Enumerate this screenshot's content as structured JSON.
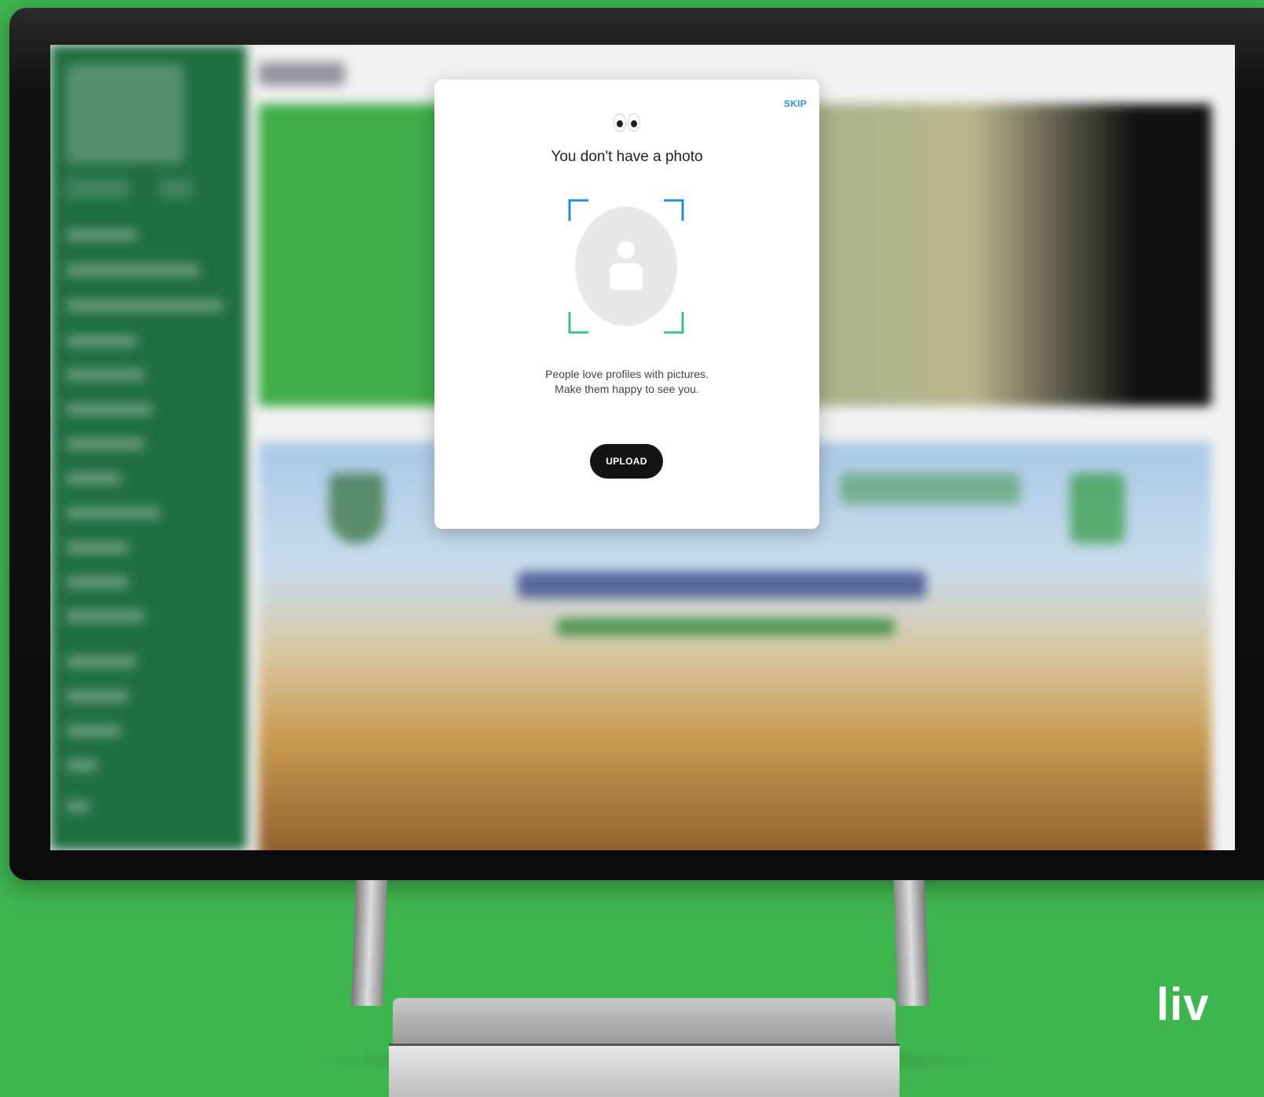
{
  "modal": {
    "skip_label": "SKIP",
    "eyes_icon": "👀",
    "title": "You don't have a photo",
    "description": "People love profiles with pictures. Make them happy to see you.",
    "upload_label": "UPLOAD",
    "avatar_icon": "user-placeholder-icon"
  },
  "branding": {
    "logo_text": "liv"
  },
  "colors": {
    "background_green": "#3fb54f",
    "sidebar_green": "#1f6e40",
    "skip_blue": "#1f9bd6",
    "upload_button": "#141414",
    "frame_blue": "#1f8fd6",
    "frame_green": "#3cc088"
  }
}
